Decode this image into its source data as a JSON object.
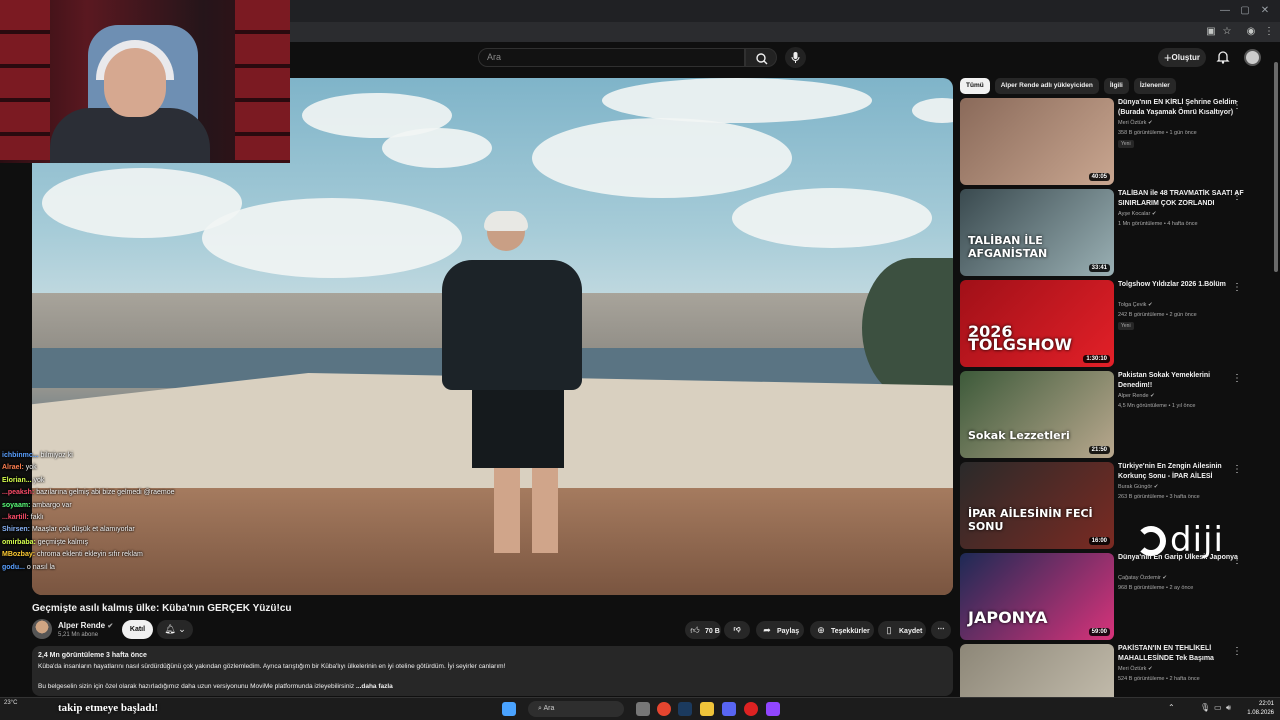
{
  "header": {
    "search_placeholder": "Ara",
    "create_label": "Oluştur"
  },
  "video": {
    "title": "Geçmişte asılı kalmış ülke: Küba'nın GERÇEK Yüzü!cu",
    "channel": "Alper Rende",
    "subscribers": "5,21 Mn abone",
    "join_label": "Katıl",
    "likes": "70 B",
    "share_label": "Paylaş",
    "thanks_label": "Teşekkürler",
    "save_label": "Kaydet",
    "views_date": "2,4 Mn görüntüleme  3 hafta önce",
    "description_line1": "Küba'da insanların hayatlarını nasıl sürdürdüğünü çok yakından gözlemledim. Ayrıca tarıştığım bir Küba'lıyı ülkelerinin en iyi oteline götürdüm. İyi seyirler canlarım!",
    "description_line2": "Bu belgeselin sizin için özel olarak hazırladığımız daha uzun versiyonunu MoviMe platformunda izleyebilirsiniz",
    "more_label": "...daha fazla"
  },
  "chips": [
    "Tümü",
    "Alper Rende adlı yükleyiciden",
    "İlgili",
    "İzlenenler"
  ],
  "recommendations": [
    {
      "title": "Dünya'nın EN KİRLİ Şehrine Geldim (Burada Yaşamak Ömrü Kısaltıyor)",
      "channel": "Meri Öztürk",
      "meta": "358 B görüntüleme • 1 gün önce",
      "badge": "Yeni",
      "duration": "40:05",
      "colors": [
        "#8a6a5a",
        "#c9a690"
      ],
      "overlay": ""
    },
    {
      "title": "TALİBAN ile 48 TRAVMATİK SAAT! AF SINIRLARIM ÇOK ZORLANDI",
      "channel": "Ayşe Kocalar",
      "meta": "1 Mn görüntüleme • 4 hafta önce",
      "badge": "",
      "duration": "33:41",
      "colors": [
        "#3a4a4f",
        "#9ab0b4"
      ],
      "overlay": "TALİBAN İLE AFGANİSTAN"
    },
    {
      "title": "Tolgshow Yıldızlar 2026 1.Bölüm",
      "channel": "Tolga Çevik",
      "meta": "242 B görüntüleme • 2 gün önce",
      "badge": "Yeni",
      "duration": "1:30:10",
      "colors": [
        "#a01018",
        "#e32028"
      ],
      "overlay": "2026 TOLGSHOW"
    },
    {
      "title": "Pakistan Sokak Yemeklerini Denedim!!",
      "channel": "Alper Rende",
      "meta": "4,5 Mn görüntüleme • 1 yıl önce",
      "badge": "",
      "duration": "21:50",
      "colors": [
        "#3d5a3a",
        "#b9a88e"
      ],
      "overlay": "Sokak Lezzetleri"
    },
    {
      "title": "Türkiye'nin En Zengin Ailesinin Korkunç Sonu - İPAR AİLESİ",
      "channel": "Burak Güngör",
      "meta": "263 B görüntüleme • 3 hafta önce",
      "badge": "",
      "duration": "16:00",
      "colors": [
        "#2a2a2a",
        "#7b2a22"
      ],
      "overlay": "İPAR AİLESİNİN FECİ SONU"
    },
    {
      "title": "Dünya'nın En Garip Ülkesi: Japonya",
      "channel": "Çağatay Özdemir",
      "meta": "968 B görüntüleme • 2 ay önce",
      "badge": "",
      "duration": "59:00",
      "colors": [
        "#1d2a55",
        "#d8337a"
      ],
      "overlay": "JAPONYA"
    },
    {
      "title": "PAKİSTAN'IN EN TEHLİKELİ MAHALLESİNDE Tek Başıma",
      "channel": "Meri Öztürk",
      "meta": "524 B görüntüleme • 2 hafta önce",
      "badge": "",
      "duration": "",
      "colors": [
        "#8d8778",
        "#c9c2b2"
      ],
      "overlay": ""
    }
  ],
  "chat": [
    {
      "user": "ichbinmc...",
      "msg": "bilmiyoz ki",
      "color": "#5aa0ff"
    },
    {
      "user": "Alrael:",
      "msg": "yok",
      "color": "#ff7f50"
    },
    {
      "user": "Elorian...",
      "msg": "yok",
      "color": "#d6ff4d"
    },
    {
      "user": "...peaksh:",
      "msg": "bazılarına gelmiş abi bize gelmedi @raemoe",
      "color": "#ff4d6a"
    },
    {
      "user": "soyaam:",
      "msg": "ambargo var",
      "color": "#5aff7a"
    },
    {
      "user": "...kartill:",
      "msg": "faklı",
      "color": "#ff4d6a"
    },
    {
      "user": "Shirsen:",
      "msg": "Maaşlar çok düşük et alamıyorlar",
      "color": "#8ab4f8"
    },
    {
      "user": "omirbaba:",
      "msg": "geçmişte kalmış",
      "color": "#d6ff4d"
    },
    {
      "user": "MBozbay:",
      "msg": "chroma eklenti ekleyin sıfır reklam",
      "color": "#ffcc33"
    },
    {
      "user": "godu...",
      "msg": "o nasıl la",
      "color": "#5aa0ff"
    }
  ],
  "watermark_text": "diji",
  "taskbar": {
    "follow_text": "takip etmeye başladı!",
    "weather": "23°C",
    "search_label": "Ara",
    "time": "22:01",
    "date": "1.08.2026"
  }
}
